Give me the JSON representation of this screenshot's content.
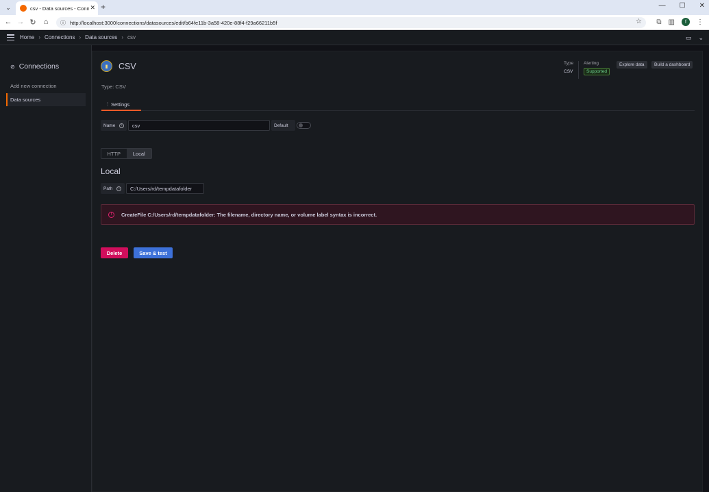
{
  "browser": {
    "tab_title": "csv - Data sources - Connectio",
    "tab_menu_icon": "chevron-down-icon",
    "url": "http://localhost:3000/connections/datasources/edit/b64fe11b-3a58-420e-88f4-f29a66211b5f",
    "profile_initial": "f"
  },
  "topnav": {
    "breadcrumbs": [
      "Home",
      "Connections",
      "Data sources",
      "csv"
    ]
  },
  "sidebar": {
    "title": "Connections",
    "items": [
      {
        "label": "Add new connection",
        "active": false
      },
      {
        "label": "Data sources",
        "active": true
      }
    ]
  },
  "datasource": {
    "name": "CSV",
    "type_text": "Type: CSV",
    "meta_type_label": "Type",
    "meta_type_value": "CSV",
    "alerting_label": "Alerting",
    "alerting_badge": "Supported",
    "explore_label": "Explore data",
    "build_label": "Build a dashboard"
  },
  "tabs": {
    "settings_label": "Settings"
  },
  "form": {
    "name_label": "Name",
    "name_value": "csv",
    "default_label": "Default",
    "default_on": false,
    "storage_options": [
      "HTTP",
      "Local"
    ],
    "storage_selected": "Local",
    "section_title": "Local",
    "path_label": "Path",
    "path_value": "C:/Users/rd/tempdatafolder"
  },
  "alert": {
    "message": "CreateFile C:/Users/rd/tempdatafolder: The filename, directory name, or volume label syntax is incorrect.",
    "color": "#e0226e"
  },
  "actions": {
    "delete_label": "Delete",
    "save_label": "Save & test"
  },
  "colors": {
    "accent": "#f46800",
    "danger": "#d10e5c",
    "primary": "#3d71d9"
  }
}
